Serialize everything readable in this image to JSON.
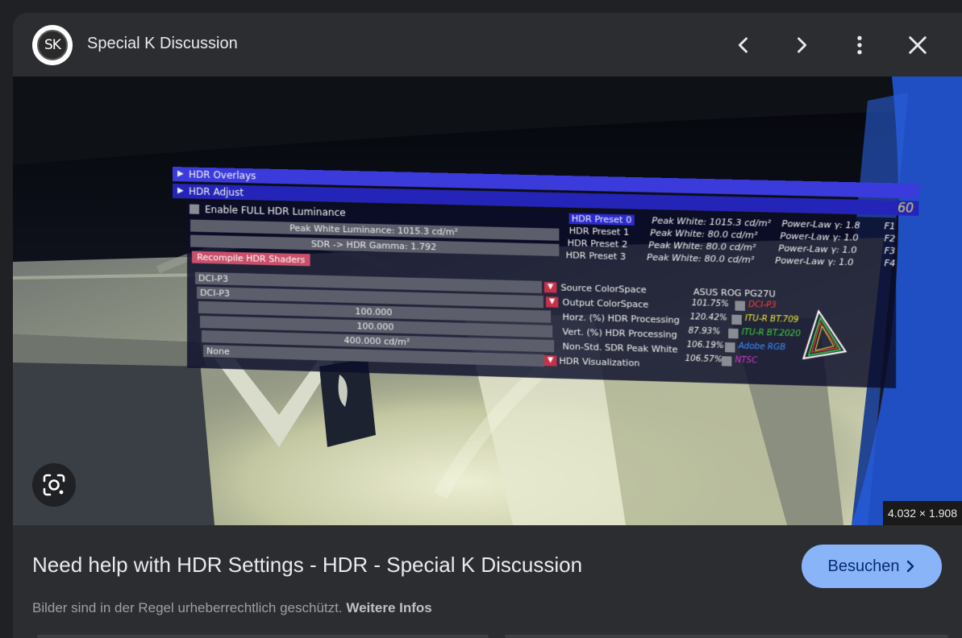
{
  "header": {
    "logo_text": "SK",
    "site_name": "Special K Discussion",
    "icons": [
      "chevron-left-icon",
      "chevron-right-icon",
      "more-vert-icon",
      "close-icon"
    ]
  },
  "image": {
    "dimensions": "4.032 × 1.908",
    "overlay": {
      "fps": "60",
      "bar_overlays": "HDR Overlays",
      "bar_adjust": "HDR Adjust",
      "enable_full": "Enable FULL HDR Luminance",
      "peak_white": "Peak White Luminance: 1015.3 cd/m²",
      "gamma": "SDR -> HDR Gamma: 1.792",
      "recompile": "Recompile HDR Shaders",
      "presets": [
        {
          "name": "HDR Preset 0",
          "peak": "Peak White: 1015.3 cd/m²",
          "power": "Power-Law γ: 1.8",
          "key": "F1"
        },
        {
          "name": "HDR Preset 1",
          "peak": "Peak White:  80.0 cd/m²",
          "power": "Power-Law γ: 1.0",
          "key": "F2"
        },
        {
          "name": "HDR Preset 2",
          "peak": "Peak White:  80.0 cd/m²",
          "power": "Power-Law γ: 1.0",
          "key": "F3"
        },
        {
          "name": "HDR Preset 3",
          "peak": "Peak White:  80.0 cd/m²",
          "power": "Power-Law γ: 1.0",
          "key": "F4"
        }
      ],
      "source_value": "DCI-P3",
      "source_label": "Source ColorSpace",
      "output_value": "DCI-P3",
      "output_label": "Output ColorSpace",
      "horz_value": "100.000",
      "horz_label": "Horz. (%) HDR Processing",
      "vert_value": "100.000",
      "vert_label": "Vert. (%) HDR Processing",
      "sdr_value": "400.000 cd/m²",
      "sdr_label": "Non-Std. SDR Peak White",
      "vis_value": "None",
      "vis_label": "HDR Visualization",
      "monitor": "ASUS ROG PG27U",
      "gamut": [
        {
          "pct": "101.75%",
          "name": "DCI-P3",
          "color": "#ff3b3b"
        },
        {
          "pct": "120.42%",
          "name": "ITU-R BT.709",
          "color": "#e8e83a"
        },
        {
          "pct": "87.93%",
          "name": "ITU-R BT.2020",
          "color": "#3bd13b"
        },
        {
          "pct": "106.19%",
          "name": "Adobe RGB",
          "color": "#3b8bff"
        },
        {
          "pct": "106.57%",
          "name": "NTSC",
          "color": "#d13bd1"
        }
      ]
    }
  },
  "footer": {
    "title": "Need help with HDR Settings - HDR - Special K Discussion",
    "visit_label": "Besuchen",
    "copyright_text": "Bilder sind in der Regel urheberrechtlich geschützt.",
    "more_info": "Weitere Infos"
  },
  "colors": {
    "background": "#202124",
    "panel": "#2c2d31",
    "visit_button": "#8ab4f8",
    "overlay_bar": "#3a3ae0"
  }
}
